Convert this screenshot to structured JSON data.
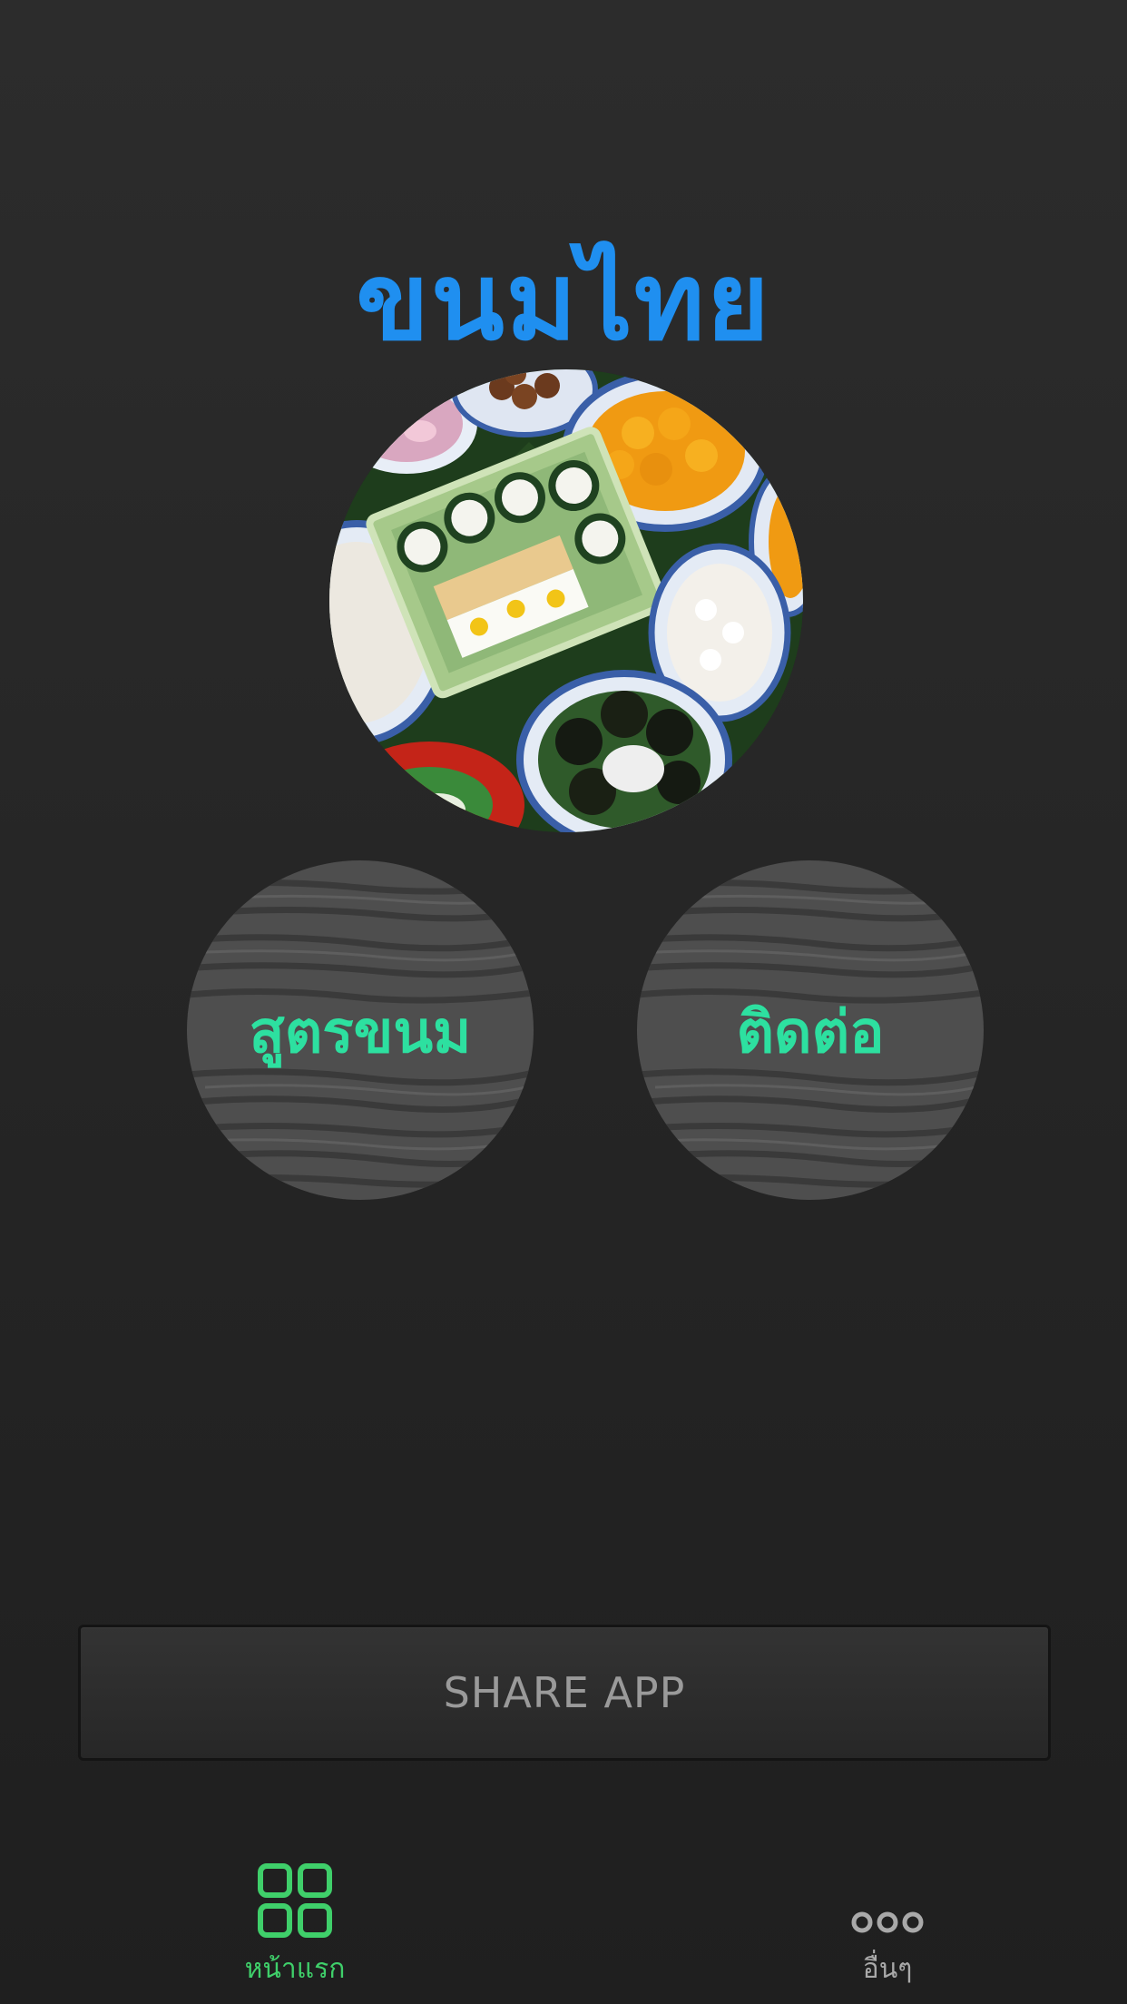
{
  "app": {
    "title": "ขนมไทย",
    "title_color": "#1f8ff0"
  },
  "hero_image": {
    "icon": "thai-desserts-photo"
  },
  "menu": {
    "recipes_label": "สูตรขนม",
    "contact_label": "ติดต่อ",
    "label_color": "#2de0a0"
  },
  "share": {
    "label": "SHARE APP"
  },
  "tabbar": {
    "home_label": "หน้าแรก",
    "home_icon": "grid-icon",
    "home_color": "#3fcf6a",
    "more_label": "อื่นๆ",
    "more_icon": "more-dots-icon",
    "more_color": "#a9a9a9"
  }
}
